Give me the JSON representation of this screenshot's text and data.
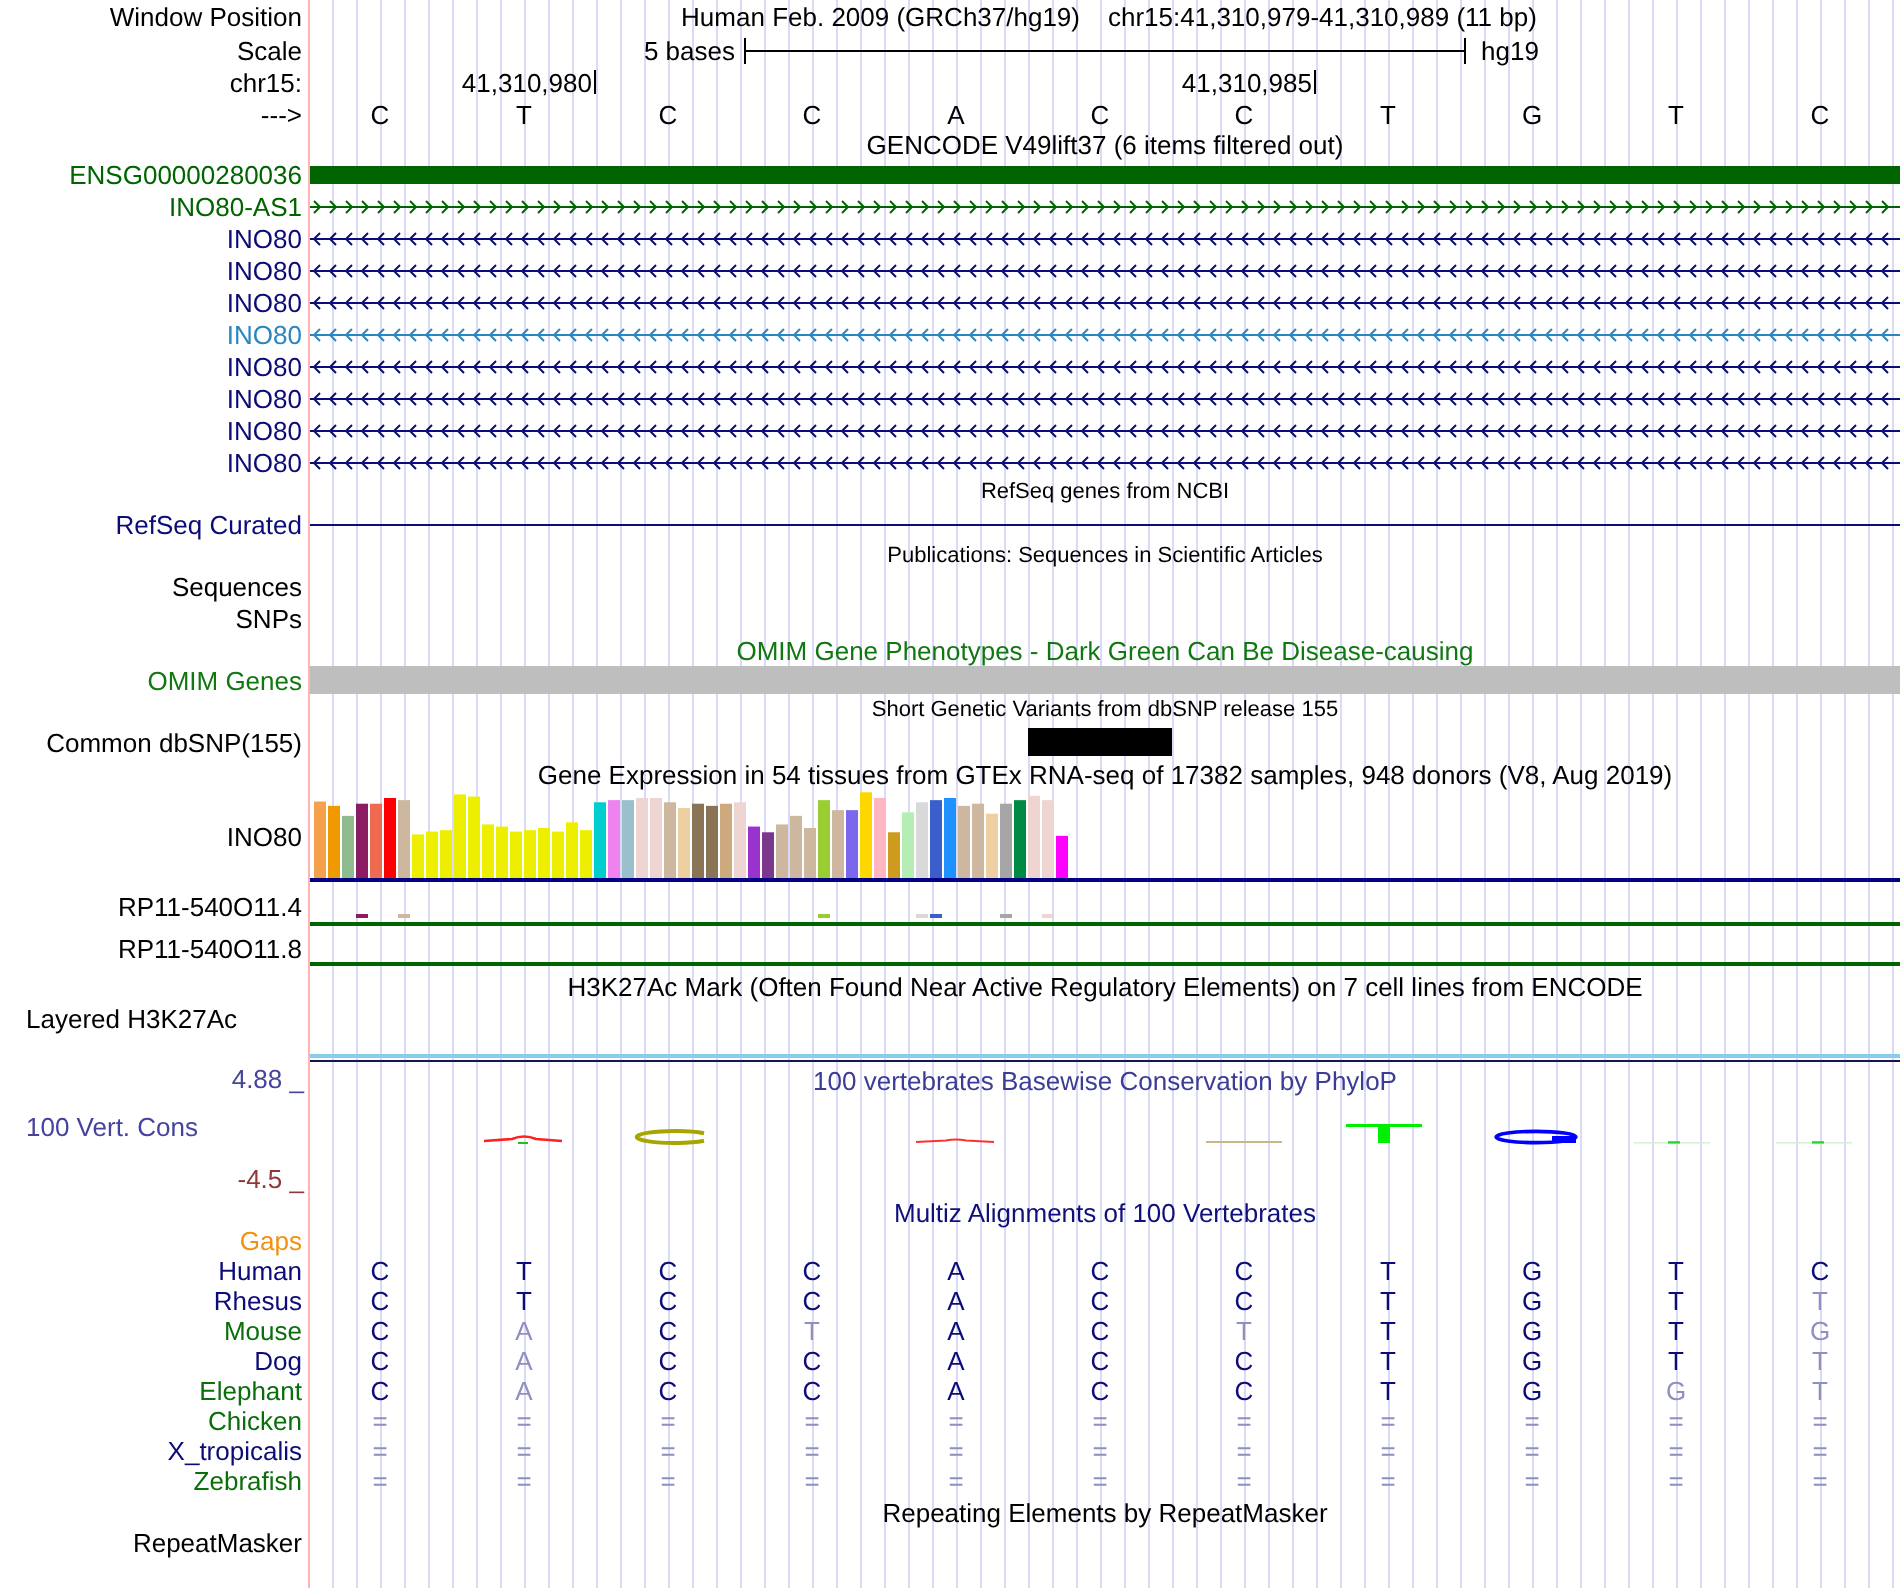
{
  "header": {
    "label": "Window Position",
    "assembly": "Human Feb. 2009 (GRCh37/hg19)",
    "position": "chr15:41,310,979-41,310,989 (11 bp)"
  },
  "scale": {
    "label": "Scale",
    "bar_label": "5 bases",
    "assembly": "hg19"
  },
  "ruler": {
    "label": "chr15:",
    "ticks": [
      "41,310,980",
      "41,310,985"
    ]
  },
  "sequence": {
    "label": "--->",
    "bases": [
      "C",
      "T",
      "C",
      "C",
      "A",
      "C",
      "C",
      "T",
      "G",
      "T",
      "C"
    ]
  },
  "gencode": {
    "title": "GENCODE V49lift37 (6 items filtered out)",
    "genes": [
      {
        "name": "ENSG00000280036",
        "kind": "block",
        "color": "#006400"
      },
      {
        "name": "INO80-AS1",
        "kind": "forward",
        "color": "#006400"
      },
      {
        "name": "INO80",
        "kind": "reverse",
        "color": "#0c0c78"
      },
      {
        "name": "INO80",
        "kind": "reverse",
        "color": "#0c0c78"
      },
      {
        "name": "INO80",
        "kind": "reverse",
        "color": "#0c0c78"
      },
      {
        "name": "INO80",
        "kind": "reverse",
        "color": "#2b86c0"
      },
      {
        "name": "INO80",
        "kind": "reverse",
        "color": "#0c0c78"
      },
      {
        "name": "INO80",
        "kind": "reverse",
        "color": "#0c0c78"
      },
      {
        "name": "INO80",
        "kind": "reverse",
        "color": "#0c0c78"
      },
      {
        "name": "INO80",
        "kind": "reverse",
        "color": "#0c0c78"
      }
    ]
  },
  "refseq": {
    "title": "RefSeq genes from NCBI",
    "label": "RefSeq Curated"
  },
  "publications": {
    "title": "Publications: Sequences in Scientific Articles",
    "label_lines": [
      "Sequences",
      "SNPs"
    ]
  },
  "omim": {
    "title": "OMIM Gene Phenotypes - Dark Green Can Be Disease-causing",
    "label": "OMIM Genes"
  },
  "dbsnp": {
    "title": "Short Genetic Variants from dbSNP release 155",
    "label": "Common dbSNP(155)"
  },
  "gtex": {
    "title": "Gene Expression in 54 tissues from GTEx RNA-seq of 17382 samples, 948 donors (V8, Aug 2019)",
    "genes": [
      {
        "name": "INO80",
        "kind": "bars",
        "color": "#000080"
      },
      {
        "name": "RP11-540O11.4",
        "kind": "ticks",
        "color": "#006400"
      },
      {
        "name": "RP11-540O11.8",
        "kind": "line",
        "color": "#006400"
      }
    ]
  },
  "h3k27ac": {
    "title": "H3K27Ac Mark (Often Found Near Active Regulatory Elements) on 7 cell lines from ENCODE",
    "label": "Layered H3K27Ac"
  },
  "conservation": {
    "title": "100 vertebrates Basewise Conservation by PhyloP",
    "label": "100 Vert. Cons",
    "max_label": "4.88 _",
    "min_label": "-4.5 _"
  },
  "multiz": {
    "title": "Multiz Alignments of 100 Vertebrates",
    "gaps_label": "Gaps",
    "species": [
      {
        "name": "Human",
        "color": "#0c0c78",
        "bases": [
          {
            "base": "C",
            "faded": false
          },
          {
            "base": "T",
            "faded": false
          },
          {
            "base": "C",
            "faded": false
          },
          {
            "base": "C",
            "faded": false
          },
          {
            "base": "A",
            "faded": false
          },
          {
            "base": "C",
            "faded": false
          },
          {
            "base": "C",
            "faded": false
          },
          {
            "base": "T",
            "faded": false
          },
          {
            "base": "G",
            "faded": false
          },
          {
            "base": "T",
            "faded": false
          },
          {
            "base": "C",
            "faded": false
          }
        ]
      },
      {
        "name": "Rhesus",
        "color": "#0c0c78",
        "bases": [
          {
            "base": "C",
            "faded": false
          },
          {
            "base": "T",
            "faded": false
          },
          {
            "base": "C",
            "faded": false
          },
          {
            "base": "C",
            "faded": false
          },
          {
            "base": "A",
            "faded": false
          },
          {
            "base": "C",
            "faded": false
          },
          {
            "base": "C",
            "faded": false
          },
          {
            "base": "T",
            "faded": false
          },
          {
            "base": "G",
            "faded": false
          },
          {
            "base": "T",
            "faded": false
          },
          {
            "base": "T",
            "faded": true
          }
        ]
      },
      {
        "name": "Mouse",
        "color": "#0a6e0a",
        "bases": [
          {
            "base": "C",
            "faded": false
          },
          {
            "base": "A",
            "faded": true
          },
          {
            "base": "C",
            "faded": false
          },
          {
            "base": "T",
            "faded": true
          },
          {
            "base": "A",
            "faded": false
          },
          {
            "base": "C",
            "faded": false
          },
          {
            "base": "T",
            "faded": true
          },
          {
            "base": "T",
            "faded": false
          },
          {
            "base": "G",
            "faded": false
          },
          {
            "base": "T",
            "faded": false
          },
          {
            "base": "G",
            "faded": true
          }
        ]
      },
      {
        "name": "Dog",
        "color": "#0c0c78",
        "bases": [
          {
            "base": "C",
            "faded": false
          },
          {
            "base": "A",
            "faded": true
          },
          {
            "base": "C",
            "faded": false
          },
          {
            "base": "C",
            "faded": false
          },
          {
            "base": "A",
            "faded": false
          },
          {
            "base": "C",
            "faded": false
          },
          {
            "base": "C",
            "faded": false
          },
          {
            "base": "T",
            "faded": false
          },
          {
            "base": "G",
            "faded": false
          },
          {
            "base": "T",
            "faded": false
          },
          {
            "base": "T",
            "faded": true
          }
        ]
      },
      {
        "name": "Elephant",
        "color": "#0a6e0a",
        "bases": [
          {
            "base": "C",
            "faded": false
          },
          {
            "base": "A",
            "faded": true
          },
          {
            "base": "C",
            "faded": false
          },
          {
            "base": "C",
            "faded": false
          },
          {
            "base": "A",
            "faded": false
          },
          {
            "base": "C",
            "faded": false
          },
          {
            "base": "C",
            "faded": false
          },
          {
            "base": "T",
            "faded": false
          },
          {
            "base": "G",
            "faded": false
          },
          {
            "base": "G",
            "faded": true
          },
          {
            "base": "T",
            "faded": true
          }
        ]
      },
      {
        "name": "Chicken",
        "color": "#0a6e0a",
        "bases": [
          {
            "base": "=",
            "faded": true
          },
          {
            "base": "=",
            "faded": true
          },
          {
            "base": "=",
            "faded": true
          },
          {
            "base": "=",
            "faded": true
          },
          {
            "base": "=",
            "faded": true
          },
          {
            "base": "=",
            "faded": true
          },
          {
            "base": "=",
            "faded": true
          },
          {
            "base": "=",
            "faded": true
          },
          {
            "base": "=",
            "faded": true
          },
          {
            "base": "=",
            "faded": true
          },
          {
            "base": "=",
            "faded": true
          }
        ]
      },
      {
        "name": "X_tropicalis",
        "color": "#0c0c78",
        "bases": [
          {
            "base": "=",
            "faded": true
          },
          {
            "base": "=",
            "faded": true
          },
          {
            "base": "=",
            "faded": true
          },
          {
            "base": "=",
            "faded": true
          },
          {
            "base": "=",
            "faded": true
          },
          {
            "base": "=",
            "faded": true
          },
          {
            "base": "=",
            "faded": true
          },
          {
            "base": "=",
            "faded": true
          },
          {
            "base": "=",
            "faded": true
          },
          {
            "base": "=",
            "faded": true
          },
          {
            "base": "=",
            "faded": true
          }
        ]
      },
      {
        "name": "Zebrafish",
        "color": "#0a6e0a",
        "bases": [
          {
            "base": "=",
            "faded": true
          },
          {
            "base": "=",
            "faded": true
          },
          {
            "base": "=",
            "faded": true
          },
          {
            "base": "=",
            "faded": true
          },
          {
            "base": "=",
            "faded": true
          },
          {
            "base": "=",
            "faded": true
          },
          {
            "base": "=",
            "faded": true
          },
          {
            "base": "=",
            "faded": true
          },
          {
            "base": "=",
            "faded": true
          },
          {
            "base": "=",
            "faded": true
          },
          {
            "base": "=",
            "faded": true
          }
        ]
      }
    ]
  },
  "repeatmasker": {
    "title": "Repeating Elements by RepeatMasker",
    "label": "RepeatMasker"
  }
}
